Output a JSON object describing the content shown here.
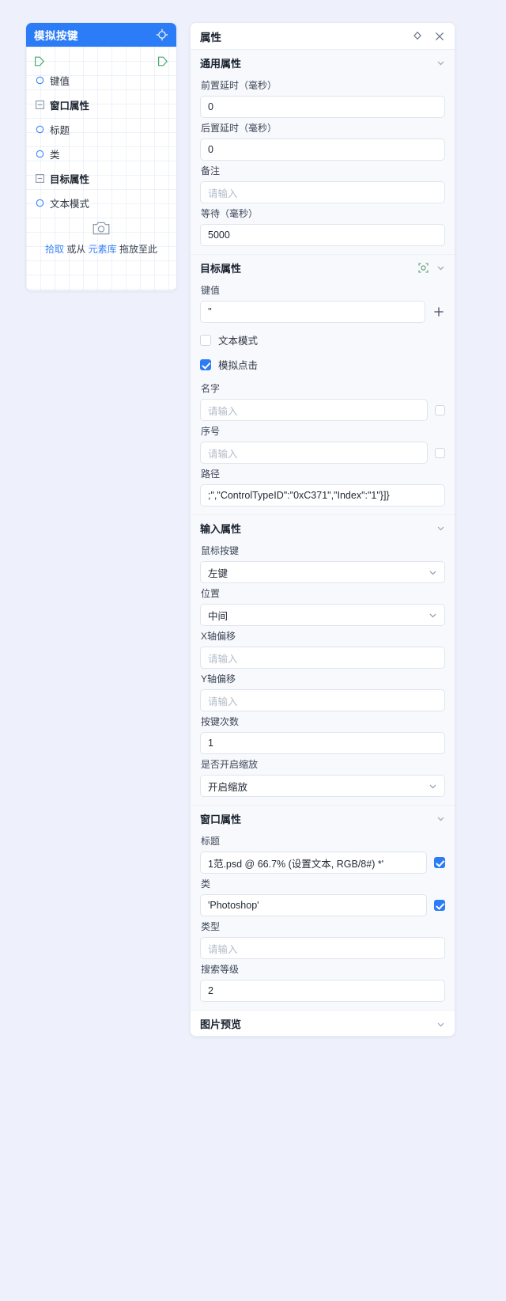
{
  "left_panel": {
    "title": "模拟按键",
    "header_icon": "crosshair-icon",
    "nodes": [
      {
        "label": "键值",
        "type": "leaf"
      },
      {
        "label": "窗口属性",
        "type": "group"
      },
      {
        "label": "标题",
        "type": "leaf"
      },
      {
        "label": "类",
        "type": "leaf"
      },
      {
        "label": "目标属性",
        "type": "group"
      },
      {
        "label": "文本模式",
        "type": "leaf"
      }
    ],
    "drop": {
      "pick_label": "拾取",
      "mid_label": "或从",
      "lib_label": "元素库",
      "tail_label": "拖放至此"
    }
  },
  "right_panel": {
    "title": "属性",
    "actions": [
      {
        "name": "collapse-expand-icon"
      },
      {
        "name": "close-icon"
      }
    ],
    "sections": {
      "general": {
        "title": "通用属性",
        "fields": [
          {
            "label": "前置延时（毫秒）",
            "value": "0",
            "placeholder": ""
          },
          {
            "label": "后置延时（毫秒）",
            "value": "0",
            "placeholder": ""
          },
          {
            "label": "备注",
            "value": "",
            "placeholder": "请输入"
          },
          {
            "label": "等待（毫秒）",
            "value": "5000",
            "placeholder": ""
          }
        ]
      },
      "target": {
        "title": "目标属性",
        "pick_icon": "element-picker-icon",
        "keyvalue_label": "键值",
        "keyvalue_value": "''",
        "add_icon": "plus-icon",
        "text_mode_label": "文本模式",
        "text_mode_checked": false,
        "simulate_click_label": "模拟点击",
        "simulate_click_checked": true,
        "name_label": "名字",
        "name_value": "",
        "name_placeholder": "请输入",
        "name_checked": false,
        "index_label": "序号",
        "index_value": "",
        "index_placeholder": "请输入",
        "index_checked": false,
        "path_label": "路径",
        "path_value": ";\",\"ControlTypeID\":\"0xC371\",\"Index\":\"1\"}]}"
      },
      "input": {
        "title": "输入属性",
        "mouse_button_label": "鼠标按键",
        "mouse_button_value": "左键",
        "position_label": "位置",
        "position_value": "中间",
        "x_offset_label": "X轴偏移",
        "x_offset_value": "",
        "x_offset_placeholder": "请输入",
        "y_offset_label": "Y轴偏移",
        "y_offset_value": "",
        "y_offset_placeholder": "请输入",
        "click_count_label": "按键次数",
        "click_count_value": "1",
        "zoom_label": "是否开启缩放",
        "zoom_value": "开启缩放"
      },
      "window": {
        "title": "窗口属性",
        "title_label": "标题",
        "title_value": "1范.psd @ 66.7% (设置文本, RGB/8#) *'",
        "title_checked": true,
        "class_label": "类",
        "class_value": "'Photoshop'",
        "class_checked": true,
        "type_label": "类型",
        "type_value": "",
        "type_placeholder": "请输入",
        "search_level_label": "搜索等级",
        "search_level_value": "2"
      },
      "preview": {
        "title": "图片预览"
      }
    }
  },
  "colors": {
    "accent": "#2b7cf6",
    "page_bg": "#eef1fb",
    "section_bg": "#f7f9fc",
    "link": "#3b82f6",
    "port_green": "#4aa86b"
  }
}
